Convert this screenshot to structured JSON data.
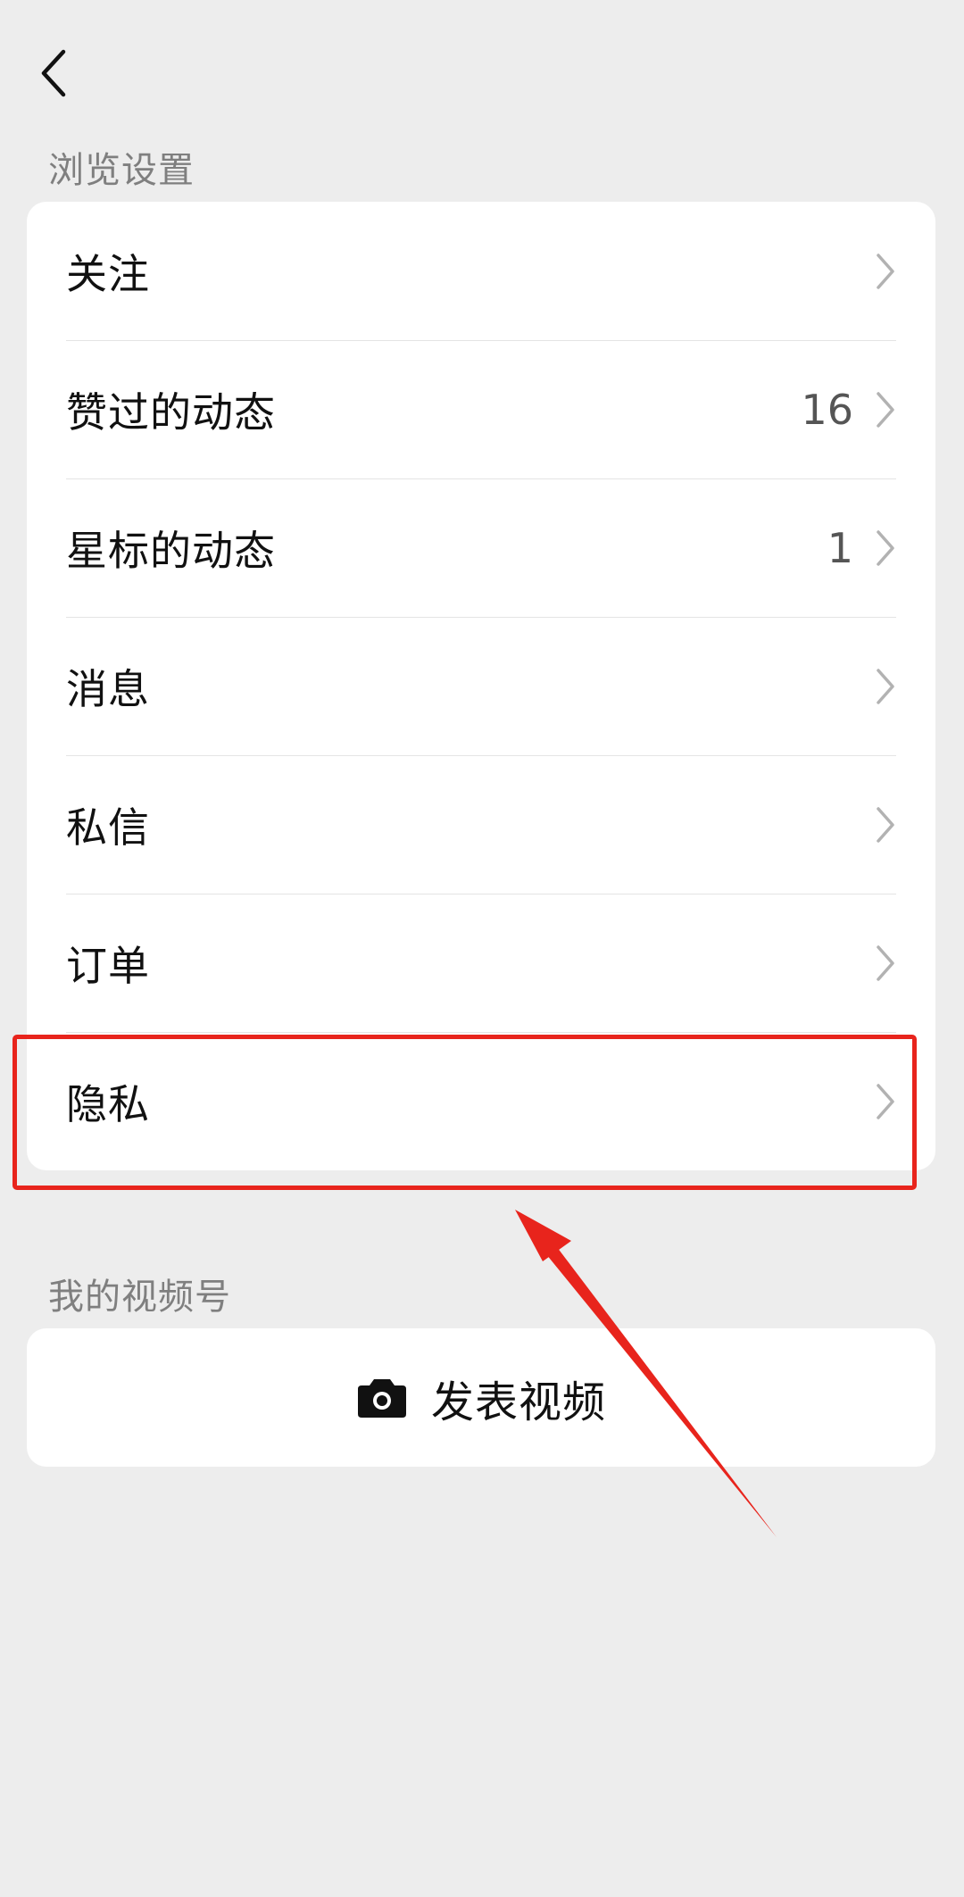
{
  "header": {
    "back_icon": "chevron-left-icon"
  },
  "browse_section": {
    "title": "浏览设置",
    "items": [
      {
        "label": "关注",
        "count": ""
      },
      {
        "label": "赞过的动态",
        "count": "16"
      },
      {
        "label": "星标的动态",
        "count": "1"
      },
      {
        "label": "消息",
        "count": ""
      },
      {
        "label": "私信",
        "count": ""
      },
      {
        "label": "订单",
        "count": ""
      },
      {
        "label": "隐私",
        "count": ""
      }
    ]
  },
  "channel_section": {
    "title": "我的视频号",
    "post_button": {
      "label": "发表视频",
      "icon": "camera-icon"
    }
  },
  "annotation": {
    "highlight_color": "#e8241c",
    "highlighted_item": "隐私"
  }
}
